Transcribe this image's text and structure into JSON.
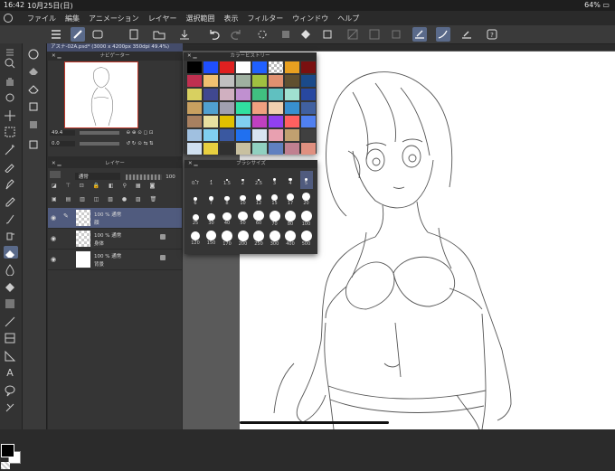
{
  "status": {
    "time": "16:42",
    "date": "10月25日(日)",
    "battery": "64%"
  },
  "menu": [
    "ファイル",
    "編集",
    "アニメーション",
    "レイヤー",
    "選択範囲",
    "表示",
    "フィルター",
    "ウィンドウ",
    "ヘルプ"
  ],
  "document_tab": "アスナ-02A.psd* (3000 x 4200px 350dpi 49.4%)",
  "navigator": {
    "title": "ナビゲーター",
    "zoom": "49.4",
    "rotation": "0.0"
  },
  "color_history": {
    "title": "カラーヒストリー",
    "colors": [
      "#000000",
      "#1f4fff",
      "#e02020",
      "#ffffff",
      "#2060ff",
      "#checker",
      "#e8a020",
      "#7a1010",
      "#c03050",
      "#f0c070",
      "#c0c0c0",
      "#9fb0a0",
      "#a0c040",
      "#e09070",
      "#605030",
      "#1a4a8a",
      "#d8d060",
      "#404890",
      "#d0b0c0",
      "#c090d0",
      "#40c080",
      "#60c0c0",
      "#a0e0d0",
      "#2848a0",
      "#c8a060",
      "#50a0d0",
      "#a0a0b0",
      "#30e0a0",
      "#f0a080",
      "#f0d0b0",
      "#3890d0",
      "#4060a0",
      "#a88060",
      "#e8e0a0",
      "#e0c000",
      "#80d0f0",
      "#c040c0",
      "#9040f0",
      "#ff6060",
      "#5080f0",
      "#a0c0e0",
      "#80d0f0",
      "#3a58a0",
      "#2070f0",
      "#d8e4f0",
      "#e8a0b0",
      "#c0a070",
      "#404040",
      "#d0e0f0",
      "#e8d040",
      "#303030",
      "#c8c0a0",
      "#90d0c0",
      "#6080c0",
      "#c08090",
      "#e09080"
    ]
  },
  "layer_panel": {
    "title": "レイヤー",
    "blend_mode": "通常",
    "opacity": "100",
    "layers": [
      {
        "opacity_mode": "100 % 通常",
        "name": "顔",
        "selected": true
      },
      {
        "opacity_mode": "100 % 通常",
        "name": "身体",
        "selected": false
      },
      {
        "opacity_mode": "100 % 通常",
        "name": "背景",
        "selected": false
      }
    ]
  },
  "brush_size": {
    "title": "ブラシサイズ",
    "sizes": [
      "0.7",
      "1",
      "1.5",
      "2",
      "2.5",
      "3",
      "4",
      "5",
      "6",
      "7",
      "8",
      "10",
      "12",
      "15",
      "17",
      "20",
      "25",
      "30",
      "40",
      "50",
      "60",
      "70",
      "80",
      "100",
      "120",
      "150",
      "170",
      "200",
      "250",
      "300",
      "400",
      "500"
    ],
    "selected": "5"
  },
  "colors": {
    "accent": "#505b7e",
    "panel": "#353535",
    "paper": "#ffffff"
  },
  "icons": [
    "menu-icon",
    "brush-icon",
    "search-icon",
    "hand-icon",
    "zoom-icon",
    "move-icon",
    "lasso-icon",
    "eyedropper-icon",
    "pen-icon",
    "pencil-icon",
    "brush-tool-icon",
    "airbrush-icon",
    "eraser-icon",
    "fill-icon",
    "gradient-icon",
    "line-icon",
    "text-icon",
    "balloon-icon"
  ]
}
